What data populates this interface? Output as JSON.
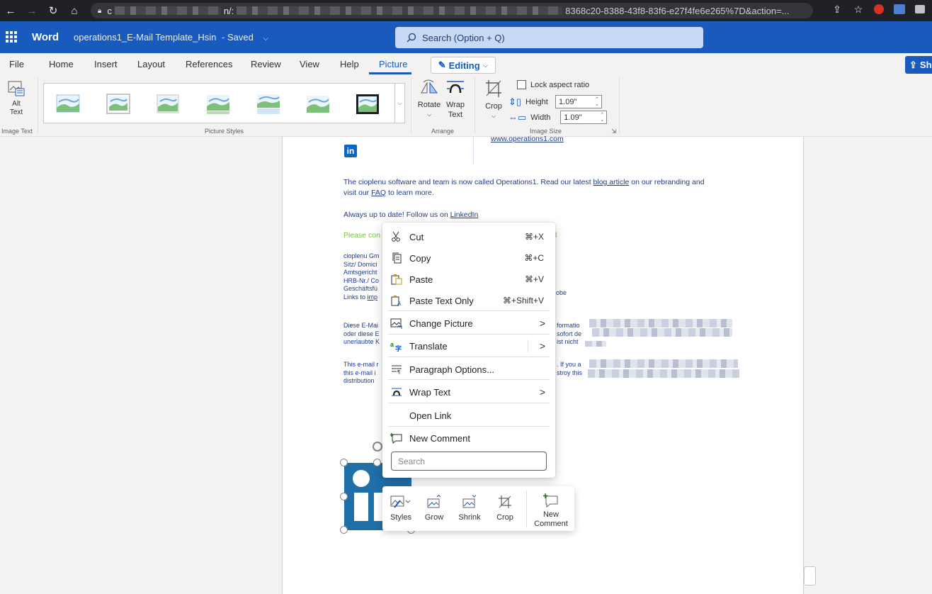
{
  "browser": {
    "url_prefix": "c",
    "url_mid": "n/:",
    "url_tail": "8368c20-8388-43f8-83f6-e27f4fe6e265%7D&action=..."
  },
  "header": {
    "app_name": "Word",
    "doc_title": "operations1_E-Mail Template_Hsin",
    "doc_status": "- Saved",
    "search_placeholder": "Search (Option + Q)",
    "accent_color": "#185abd"
  },
  "tabs": [
    "File",
    "Home",
    "Insert",
    "Layout",
    "References",
    "Review",
    "View",
    "Help",
    "Picture"
  ],
  "active_tab": "Picture",
  "editing_label": "Editing",
  "share_label": "Sh",
  "ribbon": {
    "alt_text": "Alt Text",
    "group_image_text": "Image Text",
    "group_picture_styles": "Picture Styles",
    "rotate": "Rotate",
    "wrap_text": "Wrap Text",
    "group_arrange": "Arrange",
    "crop": "Crop",
    "lock_aspect": "Lock aspect ratio",
    "height_label": "Height",
    "height_value": "1.09\"",
    "width_label": "Width",
    "width_value": "1.09\"",
    "group_image_size": "Image Size"
  },
  "document": {
    "website_link": "www.operations1.com",
    "para1_a": "The cioplenu software and team is now called Operations1. Read our latest ",
    "para1_link": "blog article",
    "para1_b": " on our rebranding and",
    "para1_c": "visit our ",
    "para1_faq": "FAQ",
    "para1_d": " to learn more.",
    "para2_a": "Always up to date! Follow us on ",
    "para2_link": "LinkedIn",
    "green_text": "Please con",
    "green_tail": "l",
    "imprint": [
      "cioplenu Gm",
      "Sitz/ Domici",
      "Amtsgericht",
      "HRB-Nr./ Co",
      "Geschäftsfü",
      "Links to "
    ],
    "imprint_link": "imp",
    "imprint_tail": "obe",
    "de_lines": [
      "Diese E-Mai",
      "oder diese E",
      "unerlaubte K"
    ],
    "de_right": [
      "formatio",
      "sofort de",
      "ist nicht"
    ],
    "en_lines": [
      "This e-mail r",
      "this e-mail i",
      "distribution"
    ],
    "en_right": [
      ". If you a",
      "stroy this"
    ]
  },
  "context_menu": {
    "items": [
      {
        "label": "Cut",
        "shortcut": "⌘+X"
      },
      {
        "label": "Copy",
        "shortcut": "⌘+C"
      },
      {
        "label": "Paste",
        "shortcut": "⌘+V"
      },
      {
        "label": "Paste Text Only",
        "shortcut": "⌘+Shift+V"
      },
      {
        "label": "Change Picture"
      },
      {
        "label": "Translate"
      },
      {
        "label": "Paragraph Options..."
      },
      {
        "label": "Wrap Text"
      },
      {
        "label": "Open Link"
      },
      {
        "label": "New Comment"
      }
    ],
    "search_placeholder": "Search"
  },
  "mini_toolbar": {
    "styles": "Styles",
    "grow": "Grow",
    "shrink": "Shrink",
    "crop": "Crop",
    "new_comment": "New Comment"
  }
}
